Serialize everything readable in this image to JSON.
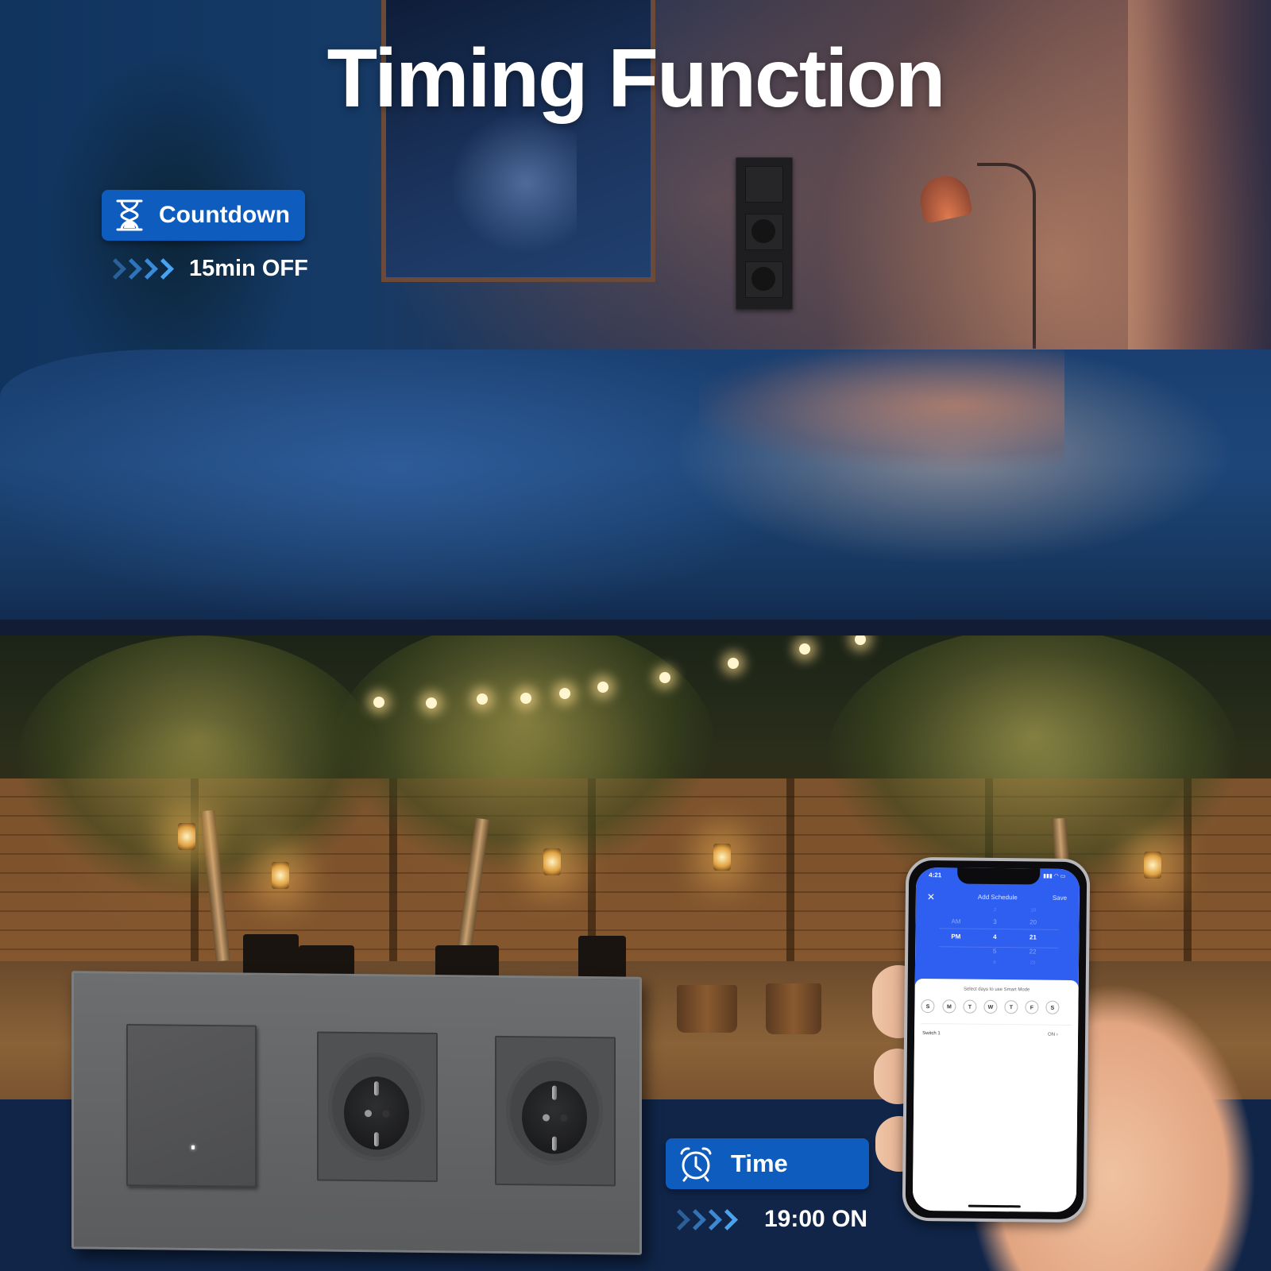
{
  "title": "Timing Function",
  "countdown": {
    "icon": "hourglass-icon",
    "label": "Countdown",
    "value": "15min OFF"
  },
  "time": {
    "icon": "alarm-clock-icon",
    "label": "Time",
    "value": "19:00 ON"
  },
  "phone": {
    "status_time": "4:21",
    "status_icons": "signal wifi battery",
    "close_icon": "✕",
    "screen_title": "Add Schedule",
    "save_label": "Save",
    "picker": {
      "period": {
        "above": "AM",
        "selected": "PM"
      },
      "hour": {
        "faint_above": "2",
        "above": "3",
        "selected": "4",
        "below": "5",
        "faint_below": "6"
      },
      "minute": {
        "faint_above": "19",
        "above": "20",
        "selected": "21",
        "below": "22",
        "faint_below": "23"
      }
    },
    "days_caption": "Select days to use Smart Mode",
    "days": [
      "S",
      "M",
      "T",
      "W",
      "T",
      "F",
      "S"
    ],
    "switch_row": {
      "label": "Switch 1",
      "state": "ON"
    },
    "accent_color": "#2f5ff0"
  },
  "colors": {
    "badge_blue": "#0f5cbf",
    "band_navy": "#102548",
    "chevron_blue": "#4aa3f0"
  }
}
